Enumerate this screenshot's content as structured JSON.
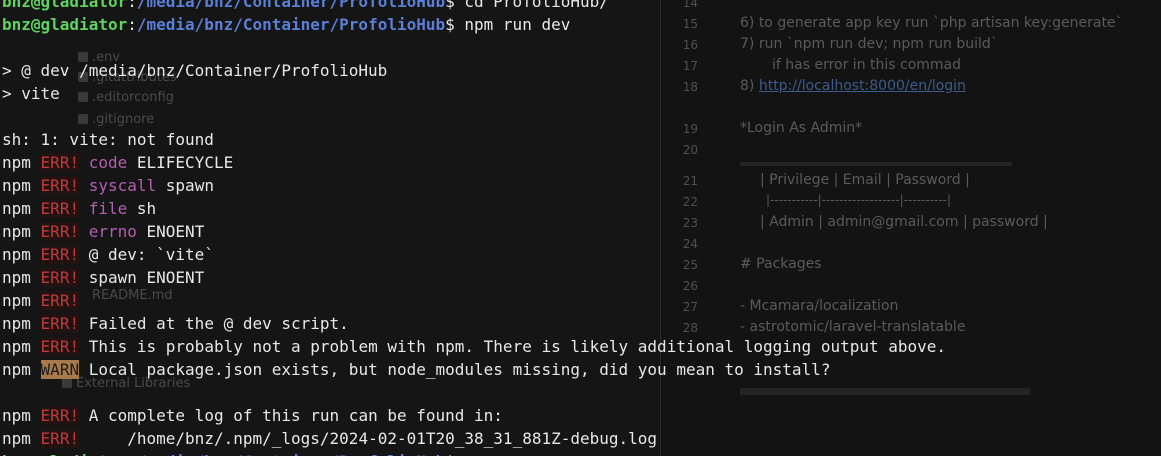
{
  "terminal": {
    "prompt_user": "bnz@gladiator",
    "prompt_path": "/media/bnz/Container/ProfolioHub",
    "prev_command": "cd ProfolioHub/",
    "command": "npm run dev",
    "run_header_1": "> @ dev /media/bnz/Container/ProfolioHub",
    "run_header_2": "> vite",
    "shell_error": "sh: 1: vite: not found",
    "npm": "npm",
    "err_tag": "ERR!",
    "warn_tag": "WARN",
    "errors": [
      {
        "key": "code",
        "val": " ELIFECYCLE"
      },
      {
        "key": "syscall",
        "val": " spawn"
      },
      {
        "key": "file",
        "val": " sh"
      },
      {
        "key": "errno",
        "val": " ENOENT"
      }
    ],
    "err_dev": "@ dev: `vite`",
    "err_spawn": "spawn ENOENT",
    "err_failed": "Failed at the @ dev script.",
    "err_problem": "This is probably not a problem with npm. There is likely additional logging output above.",
    "warn_msg": "Local package.json exists, but node_modules missing, did you mean to install?",
    "log_msg": "A complete log of this run can be found in:",
    "log_path": "/home/bnz/.npm/_logs/2024-02-01T20_38_31_881Z-debug.log"
  },
  "ide_tree": {
    "items": [
      ".env",
      ".gitattributes",
      ".editorconfig",
      ".gitignore",
      "README.md",
      "External Libraries"
    ]
  },
  "editor": {
    "gutter": [
      "14",
      "15",
      "16",
      "17",
      "18",
      "19",
      "20",
      "21",
      "22",
      "23",
      "24",
      "25",
      "26",
      "27",
      "28"
    ],
    "lines": [
      "6) to generate app key run `php artisan key:generate`",
      "7) run `npm run dev; npm run build`",
      "if has error in this commad",
      "http://localhost:8000/en/login",
      "*Login As Admin*",
      "| Privilege | Email          | Password |",
      "|-----------|------------------|----------|",
      "| Admin     | admin@gmail.com | password |",
      "# Packages",
      "- Mcamara/localization",
      "- astrotomic/laravel-translatable"
    ],
    "link_prefix": "8) "
  }
}
